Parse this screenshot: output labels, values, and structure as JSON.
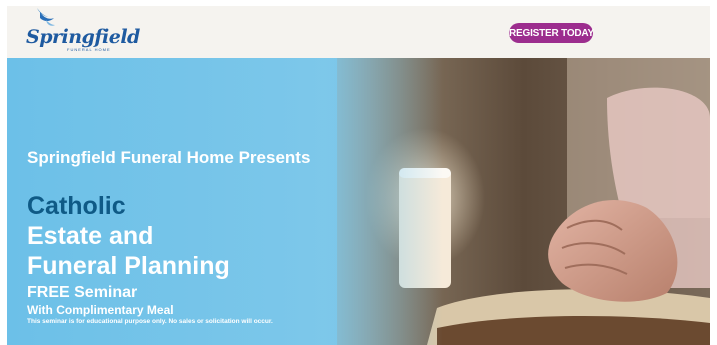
{
  "header": {
    "logo_text": "Springfield",
    "logo_subtext": "FUNERAL HOME",
    "logo_icon": "dove-icon",
    "register_label": "REGISTER TODAY"
  },
  "hero": {
    "presents": "Springfield Funeral Home Presents",
    "title_line1": "Catholic",
    "title_line2": "Estate and",
    "title_line3": "Funeral Planning",
    "free_seminar": "FREE Seminar",
    "meal": "With Complimentary Meal",
    "disclaimer": "This seminar is for educational purpose only. No sales or solicitation will occur."
  },
  "colors": {
    "brand_blue": "#1e5aa0",
    "title_blue": "#0f5a86",
    "register_purple": "#9c2d8e",
    "hero_sky": "#6cc0e8",
    "header_bg": "#f5f3ef"
  }
}
